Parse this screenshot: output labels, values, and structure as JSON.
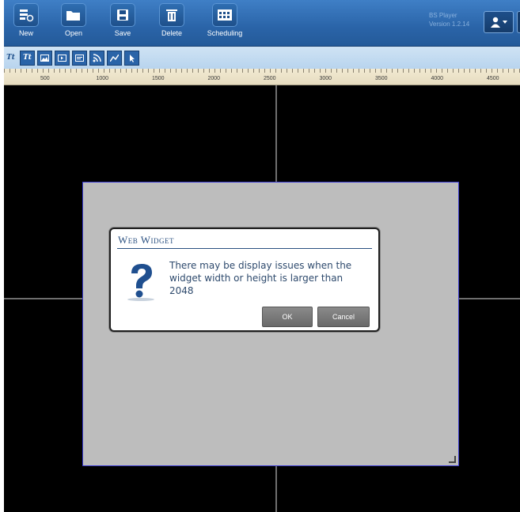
{
  "toolbar": {
    "buttons": [
      {
        "label": "New"
      },
      {
        "label": "Open"
      },
      {
        "label": "Save"
      },
      {
        "label": "Delete"
      },
      {
        "label": "Scheduling"
      }
    ],
    "app_name": "BS Player",
    "version": "Version 1.2.14"
  },
  "widget_bar": {
    "icons": [
      "Tt",
      "Tt",
      "image",
      "video",
      "web",
      "rss",
      "data",
      "pointer"
    ]
  },
  "ruler": {
    "labels": [
      "500",
      "1000",
      "1500",
      "2000",
      "2500",
      "3000",
      "3500",
      "4000",
      "4500"
    ]
  },
  "dialog": {
    "title": "Web Widget",
    "message": "There may be display issues when the widget width or height is larger than 2048",
    "ok_label": "OK",
    "cancel_label": "Cancel",
    "icon": "question-icon"
  },
  "colors": {
    "toolbar_blue": "#2a64a8",
    "canvas_black": "#000000",
    "widget_gray": "#bdbdbd"
  }
}
